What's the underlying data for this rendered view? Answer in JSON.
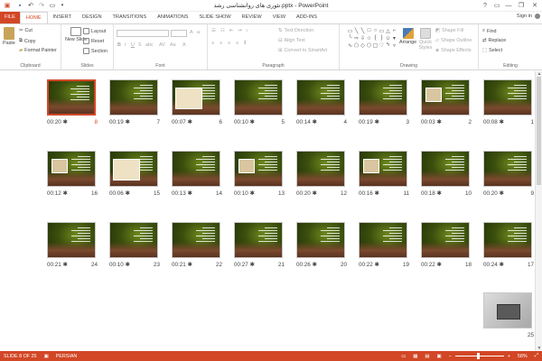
{
  "window": {
    "title": "تئوری های روانشناسی رشد.pptx - PowerPoint",
    "controls": [
      "?",
      "▭",
      "—",
      "❐",
      "✕"
    ]
  },
  "tabs": [
    "FILE",
    "HOME",
    "INSERT",
    "DESIGN",
    "TRANSITIONS",
    "ANIMATIONS",
    "SLIDE SHOW",
    "REVIEW",
    "VIEW",
    "ADD-INS"
  ],
  "active_tab": "HOME",
  "sign_in": "Sign in",
  "ribbon": {
    "clipboard": {
      "label": "Clipboard",
      "paste": "Paste",
      "cut": "Cut",
      "copy": "Copy",
      "format_painter": "Format Painter"
    },
    "slides": {
      "label": "Slides",
      "new_slide": "New Slide",
      "layout": "Layout",
      "reset": "Reset",
      "section": "Section"
    },
    "font": {
      "label": "Font"
    },
    "paragraph": {
      "label": "Paragraph",
      "text_direction": "Text Direction",
      "align_text": "Align Text",
      "convert_smartart": "Convert to SmartArt"
    },
    "drawing": {
      "label": "Drawing",
      "arrange": "Arrange",
      "quick_styles": "Quick Styles",
      "shape_fill": "Shape Fill",
      "shape_outline": "Shape Outline",
      "shape_effects": "Shape Effects"
    },
    "editing": {
      "label": "Editing",
      "find": "Find",
      "replace": "Replace",
      "select": "Select"
    }
  },
  "slides": [
    {
      "number": "1",
      "time": "00:08"
    },
    {
      "number": "2",
      "time": "00:03"
    },
    {
      "number": "3",
      "time": "00:19"
    },
    {
      "number": "4",
      "time": "00:14"
    },
    {
      "number": "5",
      "time": "00:10"
    },
    {
      "number": "6",
      "time": "00:07"
    },
    {
      "number": "7",
      "time": "00:19"
    },
    {
      "number": "8",
      "time": "00:20",
      "selected": true
    },
    {
      "number": "9",
      "time": "00:20"
    },
    {
      "number": "10",
      "time": "00:18"
    },
    {
      "number": "11",
      "time": "00:16"
    },
    {
      "number": "12",
      "time": "00:20"
    },
    {
      "number": "13",
      "time": "00:10"
    },
    {
      "number": "14",
      "time": "00:13"
    },
    {
      "number": "15",
      "time": "00:06"
    },
    {
      "number": "16",
      "time": "00:12"
    },
    {
      "number": "17",
      "time": "00:24"
    },
    {
      "number": "18",
      "time": "00:22"
    },
    {
      "number": "19",
      "time": "00:22"
    },
    {
      "number": "20",
      "time": "00:26"
    },
    {
      "number": "21",
      "time": "00:27"
    },
    {
      "number": "22",
      "time": "00:21"
    },
    {
      "number": "23",
      "time": "00:10"
    },
    {
      "number": "24",
      "time": "00:21"
    },
    {
      "number": "25",
      "time": ""
    }
  ],
  "status": {
    "slide_of": "SLIDE 8 OF 25",
    "language": "PERSIAN",
    "zoom": "58%"
  },
  "colors": {
    "accent": "#d24726"
  }
}
